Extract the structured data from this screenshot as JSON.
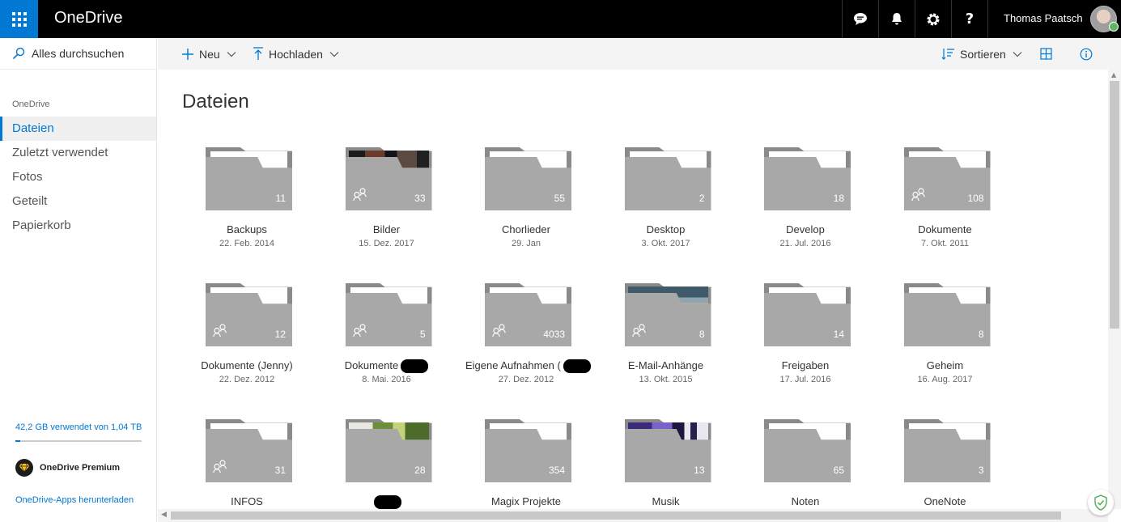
{
  "app": {
    "name": "OneDrive"
  },
  "topbar": {
    "user_name": "Thomas Paatsch",
    "icons": [
      "chat-icon",
      "bell-icon",
      "gear-icon",
      "help-icon"
    ],
    "help_glyph": "?"
  },
  "sidebar": {
    "search_label": "Alles durchsuchen",
    "section_title": "OneDrive",
    "items": [
      {
        "label": "Dateien",
        "active": true
      },
      {
        "label": "Zuletzt verwendet",
        "active": false
      },
      {
        "label": "Fotos",
        "active": false
      },
      {
        "label": "Geteilt",
        "active": false
      },
      {
        "label": "Papierkorb",
        "active": false
      }
    ],
    "storage_text": "42,2 GB verwendet von 1,04 TB",
    "storage_fraction": 0.04,
    "premium_label": "OneDrive Premium",
    "apps_link": "OneDrive-Apps herunterladen"
  },
  "commandbar": {
    "new_label": "Neu",
    "upload_label": "Hochladen",
    "sort_label": "Sortieren"
  },
  "main": {
    "title": "Dateien",
    "folders": [
      {
        "name": "Backups",
        "date": "22. Feb. 2014",
        "count": "11",
        "shared": false,
        "thumb": ""
      },
      {
        "name": "Bilder",
        "date": "15. Dez. 2017",
        "count": "33",
        "shared": true,
        "thumb": "dark"
      },
      {
        "name": "Chorlieder",
        "date": "29. Jan",
        "count": "55",
        "shared": false,
        "thumb": ""
      },
      {
        "name": "Desktop",
        "date": "3. Okt. 2017",
        "count": "2",
        "shared": false,
        "thumb": ""
      },
      {
        "name": "Develop",
        "date": "21. Jul. 2016",
        "count": "18",
        "shared": false,
        "thumb": ""
      },
      {
        "name": "Dokumente",
        "date": "7. Okt. 2011",
        "count": "108",
        "shared": true,
        "thumb": ""
      },
      {
        "name": "Dokumente (Jenny)",
        "date": "22. Dez. 2012",
        "count": "12",
        "shared": true,
        "thumb": ""
      },
      {
        "name": "Dokumente",
        "date": "8. Mai. 2016",
        "count": "5",
        "shared": true,
        "thumb": "",
        "redacted": true
      },
      {
        "name": "Eigene Aufnahmen (",
        "date": "27. Dez. 2012",
        "count": "4033",
        "shared": true,
        "thumb": "",
        "redacted": true
      },
      {
        "name": "E-Mail-Anhänge",
        "date": "13. Okt. 2015",
        "count": "8",
        "shared": true,
        "thumb": "office"
      },
      {
        "name": "Freigaben",
        "date": "17. Jul. 2016",
        "count": "14",
        "shared": false,
        "thumb": ""
      },
      {
        "name": "Geheim",
        "date": "16. Aug. 2017",
        "count": "8",
        "shared": false,
        "thumb": ""
      },
      {
        "name": "INFOS",
        "date": "",
        "count": "31",
        "shared": true,
        "thumb": ""
      },
      {
        "name": "",
        "date": "",
        "count": "28",
        "shared": false,
        "thumb": "food",
        "redacted": true
      },
      {
        "name": "Magix Projekte",
        "date": "",
        "count": "354",
        "shared": false,
        "thumb": ""
      },
      {
        "name": "Musik",
        "date": "",
        "count": "13",
        "shared": false,
        "thumb": "purple"
      },
      {
        "name": "Noten",
        "date": "",
        "count": "65",
        "shared": false,
        "thumb": ""
      },
      {
        "name": "OneNote",
        "date": "",
        "count": "3",
        "shared": false,
        "thumb": ""
      }
    ]
  },
  "colors": {
    "accent": "#0078d4",
    "topbar": "#000000",
    "folder_front": "#a8a8a8",
    "folder_back": "#8a8a8a"
  }
}
